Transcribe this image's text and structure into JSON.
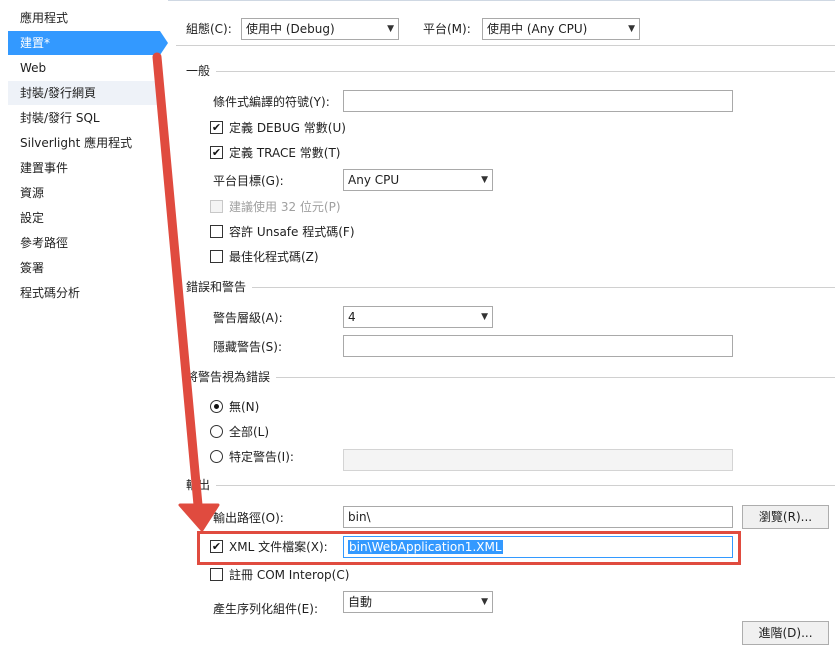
{
  "sidebar": {
    "items": [
      {
        "label": "應用程式"
      },
      {
        "label": "建置*"
      },
      {
        "label": "Web"
      },
      {
        "label": "封裝/發行網頁"
      },
      {
        "label": "封裝/發行 SQL"
      },
      {
        "label": "Silverlight 應用程式"
      },
      {
        "label": "建置事件"
      },
      {
        "label": "資源"
      },
      {
        "label": "設定"
      },
      {
        "label": "參考路徑"
      },
      {
        "label": "簽署"
      },
      {
        "label": "程式碼分析"
      }
    ]
  },
  "header": {
    "config_label": "組態(C):",
    "config_value": "使用中 (Debug)",
    "platform_label": "平台(M):",
    "platform_value": "使用中 (Any CPU)"
  },
  "general": {
    "title": "一般",
    "symbols_label": "條件式編譯的符號(Y):",
    "symbols_value": "",
    "define_debug_label": "定義 DEBUG 常數(U)",
    "define_debug_checked": true,
    "define_trace_label": "定義 TRACE 常數(T)",
    "define_trace_checked": true,
    "platform_target_label": "平台目標(G):",
    "platform_target_value": "Any CPU",
    "prefer32_label": "建議使用 32 位元(P)",
    "unsafe_label": "容許 Unsafe 程式碼(F)",
    "optimize_label": "最佳化程式碼(Z)"
  },
  "errors": {
    "title": "錯誤和警告",
    "warning_level_label": "警告層級(A):",
    "warning_level_value": "4",
    "suppress_label": "隱藏警告(S):",
    "suppress_value": ""
  },
  "treat_warnings": {
    "title": "將警告視為錯誤",
    "none_label": "無(N)",
    "all_label": "全部(L)",
    "specific_label": "特定警告(I):"
  },
  "output": {
    "title": "輸出",
    "path_label": "輸出路徑(O):",
    "path_value": "bin\\",
    "browse_label": "瀏覽(R)...",
    "xml_label": "XML 文件檔案(X):",
    "xml_checked": true,
    "xml_value": "bin\\WebApplication1.XML",
    "com_label": "註冊 COM Interop(C)",
    "serialization_label": "產生序列化組件(E):",
    "serialization_value": "自動",
    "advanced_label": "進階(D)..."
  },
  "icons": {
    "check": "✔",
    "chevron": "▼"
  },
  "colors": {
    "accent": "#3399ff",
    "annotation": "#e04b3f"
  }
}
